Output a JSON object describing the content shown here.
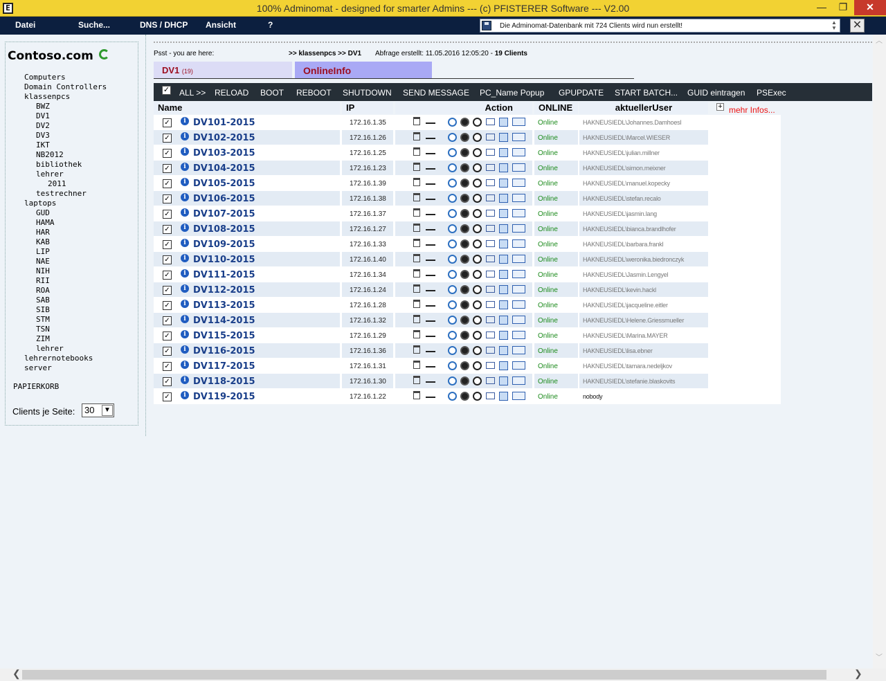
{
  "window": {
    "title": "100% Adminomat - designed for smarter Admins --- (c) PFISTERER Software --- V2.00",
    "min_glyph": "—",
    "max_glyph": "❐",
    "close_glyph": "✕",
    "app_glyph": "E"
  },
  "menu": {
    "items": [
      "Datei",
      "Suche...",
      "DNS / DHCP",
      "Ansicht",
      "?"
    ],
    "status_message": "Die Adminomat-Datenbank mit 724 Clients wird nun erstellt!",
    "close_glyph": "✕"
  },
  "sidebar": {
    "domain": "Contoso.com",
    "tree": [
      {
        "label": "Computers",
        "level": 1
      },
      {
        "label": "Domain Controllers",
        "level": 1
      },
      {
        "label": "klassenpcs",
        "level": 1
      },
      {
        "label": "BWZ",
        "level": 2
      },
      {
        "label": "DV1",
        "level": 2
      },
      {
        "label": "DV2",
        "level": 2
      },
      {
        "label": "DV3",
        "level": 2
      },
      {
        "label": "IKT",
        "level": 2
      },
      {
        "label": "NB2012",
        "level": 2
      },
      {
        "label": "bibliothek",
        "level": 2
      },
      {
        "label": "lehrer",
        "level": 2
      },
      {
        "label": "2011",
        "level": 3
      },
      {
        "label": "testrechner",
        "level": 2
      },
      {
        "label": "laptops",
        "level": 1
      },
      {
        "label": "GUD",
        "level": 2
      },
      {
        "label": "HAMA",
        "level": 2
      },
      {
        "label": "HAR",
        "level": 2
      },
      {
        "label": "KAB",
        "level": 2
      },
      {
        "label": "LIP",
        "level": 2
      },
      {
        "label": "NAE",
        "level": 2
      },
      {
        "label": "NIH",
        "level": 2
      },
      {
        "label": "RII",
        "level": 2
      },
      {
        "label": "ROA",
        "level": 2
      },
      {
        "label": "SAB",
        "level": 2
      },
      {
        "label": "SIB",
        "level": 2
      },
      {
        "label": "STM",
        "level": 2
      },
      {
        "label": "TSN",
        "level": 2
      },
      {
        "label": "ZIM",
        "level": 2
      },
      {
        "label": "lehrer",
        "level": 2
      },
      {
        "label": "lehrernotebooks",
        "level": 1
      },
      {
        "label": "server",
        "level": 1
      }
    ],
    "trash_label": "PAPIERKORB",
    "clients_per_page_label": "Clients je Seite:",
    "clients_per_page_value": "30"
  },
  "breadcrumb": {
    "prefix": "Psst - you are here:",
    "path": ">> klassenpcs >> DV1",
    "query_prefix": "Abfrage erstellt: 11.05.2016 12:05:20 - ",
    "query_count": "19 Clients"
  },
  "tabs": {
    "dv1_label": "DV1",
    "dv1_count": "(19)",
    "online_label": "OnlineInfo"
  },
  "toolbar": {
    "items": [
      "ALL >>",
      "RELOAD",
      "BOOT",
      "REBOOT",
      "SHUTDOWN",
      "SEND MESSAGE",
      "PC_Name Popup",
      "GPUPDATE",
      "START BATCH...",
      "GUID eintragen",
      "PSExec"
    ]
  },
  "table": {
    "columns": [
      "Name",
      "IP",
      "Action",
      "ONLINE",
      "aktuellerUser"
    ],
    "more_infos": "mehr Infos...",
    "plus_glyph": "+",
    "rows": [
      {
        "name": "DV101-2015",
        "ip": "172.16.1.35",
        "online": "Online",
        "user": "HAKNEUSIEDL\\Johannes.Damhoesl"
      },
      {
        "name": "DV102-2015",
        "ip": "172.16.1.26",
        "online": "Online",
        "user": "HAKNEUSIEDL\\Marcel.WIESER"
      },
      {
        "name": "DV103-2015",
        "ip": "172.16.1.25",
        "online": "Online",
        "user": "HAKNEUSIEDL\\julian.millner"
      },
      {
        "name": "DV104-2015",
        "ip": "172.16.1.23",
        "online": "Online",
        "user": "HAKNEUSIEDL\\simon.meixner"
      },
      {
        "name": "DV105-2015",
        "ip": "172.16.1.39",
        "online": "Online",
        "user": "HAKNEUSIEDL\\manuel.kopecky"
      },
      {
        "name": "DV106-2015",
        "ip": "172.16.1.38",
        "online": "Online",
        "user": "HAKNEUSIEDL\\stefan.recalo"
      },
      {
        "name": "DV107-2015",
        "ip": "172.16.1.37",
        "online": "Online",
        "user": "HAKNEUSIEDL\\jasmin.lang"
      },
      {
        "name": "DV108-2015",
        "ip": "172.16.1.27",
        "online": "Online",
        "user": "HAKNEUSIEDL\\bianca.brandlhofer"
      },
      {
        "name": "DV109-2015",
        "ip": "172.16.1.33",
        "online": "Online",
        "user": "HAKNEUSIEDL\\barbara.frankl"
      },
      {
        "name": "DV110-2015",
        "ip": "172.16.1.40",
        "online": "Online",
        "user": "HAKNEUSIEDL\\weronika.biedronczyk"
      },
      {
        "name": "DV111-2015",
        "ip": "172.16.1.34",
        "online": "Online",
        "user": "HAKNEUSIEDL\\Jasmin.Lengyel"
      },
      {
        "name": "DV112-2015",
        "ip": "172.16.1.24",
        "online": "Online",
        "user": "HAKNEUSIEDL\\kevin.hackl"
      },
      {
        "name": "DV113-2015",
        "ip": "172.16.1.28",
        "online": "Online",
        "user": "HAKNEUSIEDL\\jacqueline.eitler"
      },
      {
        "name": "DV114-2015",
        "ip": "172.16.1.32",
        "online": "Online",
        "user": "HAKNEUSIEDL\\Helene.Griessmueller"
      },
      {
        "name": "DV115-2015",
        "ip": "172.16.1.29",
        "online": "Online",
        "user": "HAKNEUSIEDL\\Marina.MAYER"
      },
      {
        "name": "DV116-2015",
        "ip": "172.16.1.36",
        "online": "Online",
        "user": "HAKNEUSIEDL\\lisa.ebner"
      },
      {
        "name": "DV117-2015",
        "ip": "172.16.1.31",
        "online": "Online",
        "user": "HAKNEUSIEDL\\tamara.nedeljkov"
      },
      {
        "name": "DV118-2015",
        "ip": "172.16.1.30",
        "online": "Online",
        "user": "HAKNEUSIEDL\\stefanie.blaskovits"
      },
      {
        "name": "DV119-2015",
        "ip": "172.16.1.22",
        "online": "Online",
        "user": "nobody"
      }
    ]
  }
}
